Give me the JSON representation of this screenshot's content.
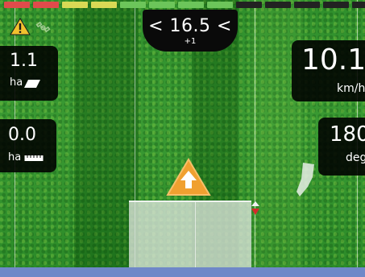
{
  "lightbar": {
    "segments": [
      "#e04b4b",
      "#e04b4b",
      "#d9d955",
      "#d9d955",
      "#6cc55a",
      "#6cc55a",
      "#6cc55a",
      "#6cc55a",
      "#222222",
      "#222222",
      "#222222",
      "#222222",
      "#222222",
      "#222222"
    ]
  },
  "status": {
    "warning_icon": "warning-triangle-icon",
    "gps_icon": "satellite-icon"
  },
  "crosstrack": {
    "value": "< 16.5 <",
    "swath": "+1"
  },
  "area": {
    "value": "1.1",
    "unit": "ha",
    "icon": "area-parallelogram-icon"
  },
  "distance": {
    "value": "0.0",
    "unit": "ha",
    "icon": "ruler-icon"
  },
  "speed": {
    "value": "10.1",
    "unit": "km/h"
  },
  "heading": {
    "value": "180",
    "unit": "deg"
  },
  "colors": {
    "accent_orange": "#f0a030",
    "field_green": "#3a9a33",
    "bottom_bar": "#6f88c8"
  }
}
